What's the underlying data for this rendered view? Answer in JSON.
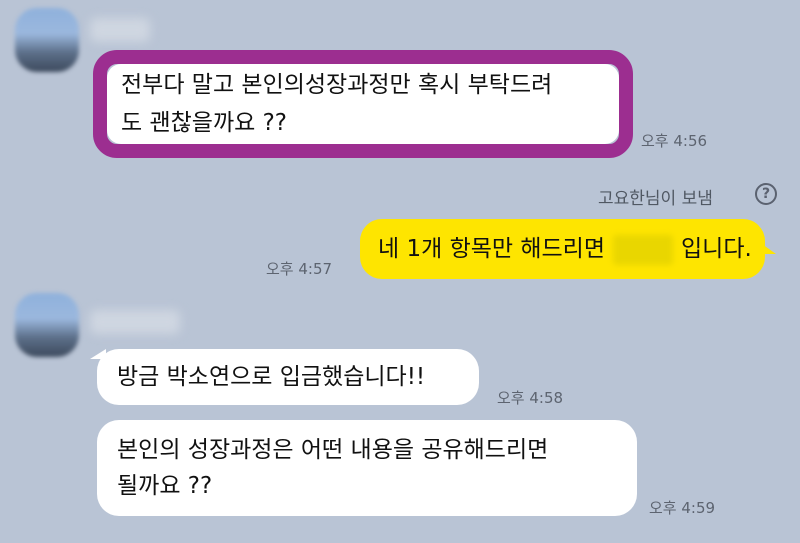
{
  "messages": [
    {
      "line1": "전부다 말고 본인의성장과정만 혹시 부탁드려",
      "line2": "도 괜찮을까요 ??",
      "time": "오후 4:56"
    },
    {
      "sent_by": "고요한님이 보냄",
      "help": "?",
      "text_before": "네 1개 항목만 해드리면",
      "text_after": "입니다.",
      "time": "오후 4:57"
    },
    {
      "text": "방금 박소연으로 입금했습니다!!",
      "time": "오후 4:58"
    },
    {
      "line1": "본인의 성장과정은 어떤 내용을 공유해드리면",
      "line2": "될까요 ??",
      "time": "오후 4:59"
    }
  ]
}
